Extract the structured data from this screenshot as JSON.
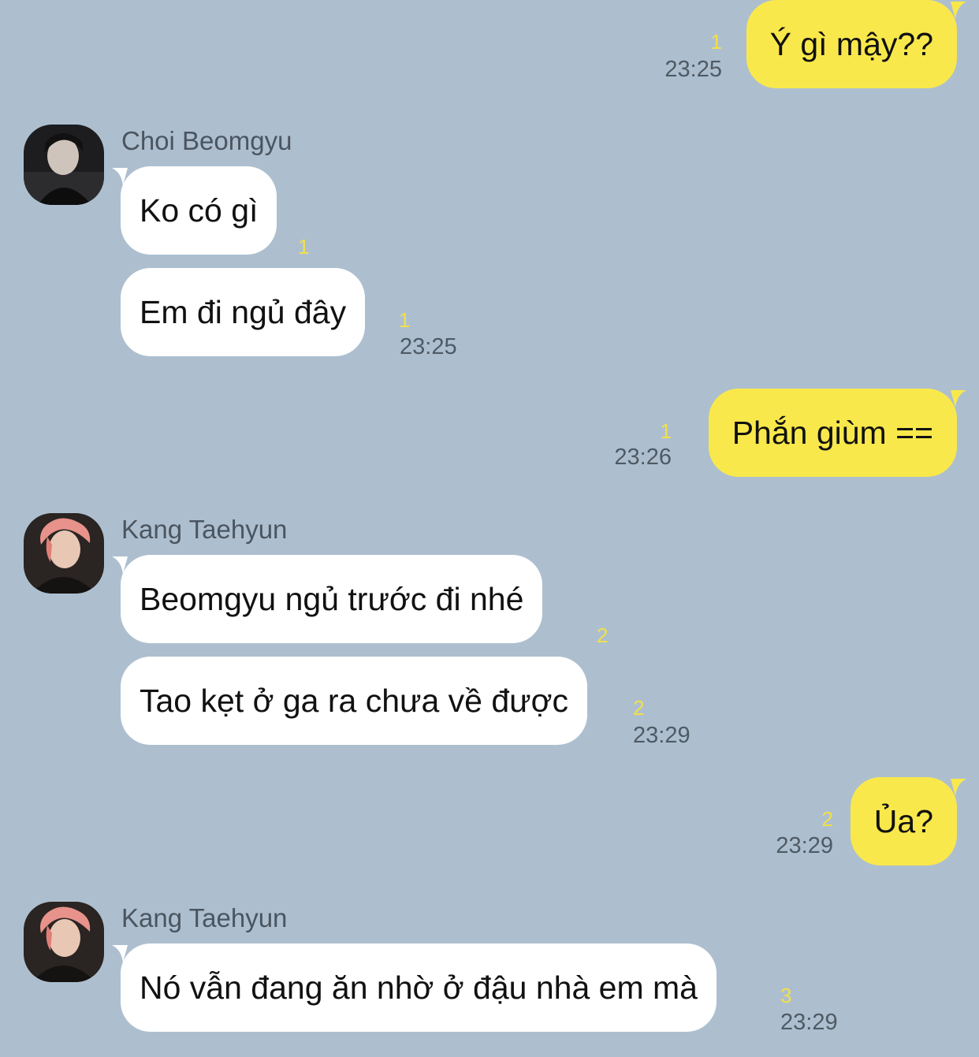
{
  "colors": {
    "background": "#adbfcf",
    "outgoing_bubble": "#f9e84b",
    "incoming_bubble": "#ffffff",
    "unread_count": "#f1e04a",
    "timestamp": "#4f5a64"
  },
  "messages": [
    {
      "id": "m1",
      "direction": "out",
      "text": "Ý gì mậy??",
      "unread": "1",
      "time": "23:25"
    },
    {
      "id": "m2",
      "direction": "in",
      "sender": "Choi Beomgyu",
      "avatar_icon": "beomgyu-avatar",
      "text": "Ko có gì",
      "unread": "1",
      "time": ""
    },
    {
      "id": "m3",
      "direction": "in",
      "sender": "",
      "text": "Em đi ngủ đây",
      "unread": "1",
      "time": "23:25"
    },
    {
      "id": "m4",
      "direction": "out",
      "text": "Phắn giùm ==",
      "unread": "1",
      "time": "23:26"
    },
    {
      "id": "m5",
      "direction": "in",
      "sender": "Kang Taehyun",
      "avatar_icon": "taehyun-avatar",
      "text": "Beomgyu ngủ trước đi nhé",
      "unread": "2",
      "time": ""
    },
    {
      "id": "m6",
      "direction": "in",
      "sender": "",
      "text": "Tao kẹt ở ga ra chưa về được",
      "unread": "2",
      "time": "23:29"
    },
    {
      "id": "m7",
      "direction": "out",
      "text": "Ủa?",
      "unread": "2",
      "time": "23:29"
    },
    {
      "id": "m8",
      "direction": "in",
      "sender": "Kang Taehyun",
      "avatar_icon": "taehyun-avatar",
      "text": "Nó vẫn đang ăn nhờ ở đậu nhà em mà",
      "unread": "3",
      "time": "23:29"
    }
  ]
}
